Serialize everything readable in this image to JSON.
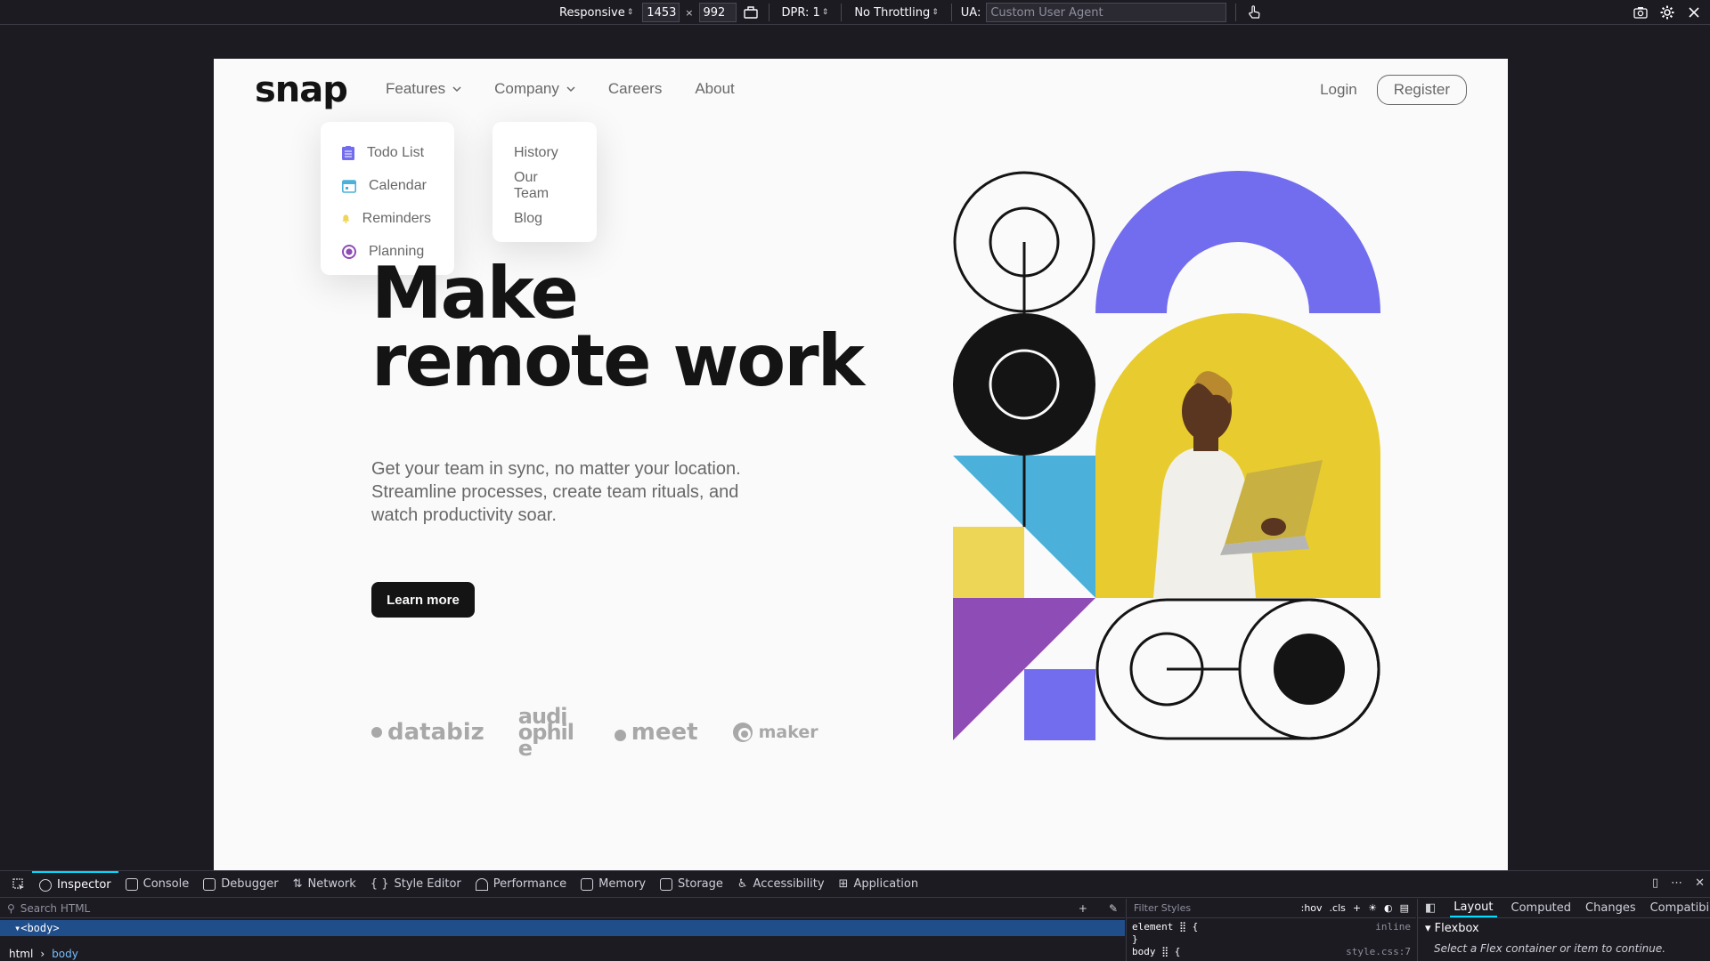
{
  "rdm": {
    "device": "Responsive",
    "width": "1453",
    "height": "992",
    "dpr": "DPR: 1",
    "throttling": "No Throttling",
    "ua_label": "UA:",
    "ua_placeholder": "Custom User Agent"
  },
  "site": {
    "logo": "snap",
    "nav": {
      "features": "Features",
      "company": "Company",
      "careers": "Careers",
      "about": "About"
    },
    "login": "Login",
    "register": "Register",
    "features_menu": [
      {
        "label": "Todo List",
        "icon": "todo-icon",
        "color": "#726cee"
      },
      {
        "label": "Calendar",
        "icon": "calendar-icon",
        "color": "#4bb1da"
      },
      {
        "label": "Reminders",
        "icon": "bell-icon",
        "color": "#edd556"
      },
      {
        "label": "Planning",
        "icon": "planning-icon",
        "color": "#8e4cb6"
      }
    ],
    "company_menu": [
      "History",
      "Our Team",
      "Blog"
    ],
    "hero": {
      "title_line1": "Make",
      "title_line2": "remote work",
      "description": "Get your team in sync, no matter your location. Streamline processes, create team rituals, and watch productivity soar.",
      "cta": "Learn more"
    },
    "clients": [
      "databiz",
      "audiophile",
      "meet",
      "maker"
    ]
  },
  "devtools": {
    "tabs": [
      "Inspector",
      "Console",
      "Debugger",
      "Network",
      "Style Editor",
      "Performance",
      "Memory",
      "Storage",
      "Accessibility",
      "Application"
    ],
    "search_placeholder": "Search HTML",
    "body_node": "<body>",
    "breadcrumb": [
      "html",
      "body"
    ],
    "filter_placeholder": "Filter Styles",
    "hov": ":hov",
    "cls": ".cls",
    "rule_element": "element ⣿ {",
    "rule_inline": "inline",
    "rule_close": "}",
    "rule_body": "body ⣿ {",
    "rule_source": "style.css:7",
    "layout_tabs": [
      "Layout",
      "Computed",
      "Changes",
      "Compatibil"
    ],
    "flexbox_title": "Flexbox",
    "flexbox_message": "Select a Flex container or item to continue."
  }
}
